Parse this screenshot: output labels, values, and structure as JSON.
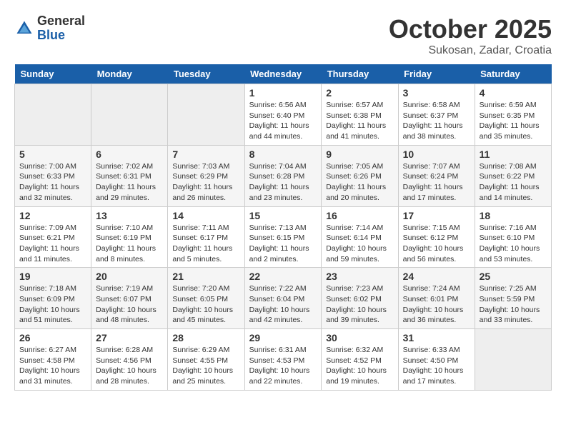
{
  "logo": {
    "general": "General",
    "blue": "Blue"
  },
  "title": "October 2025",
  "subtitle": "Sukosan, Zadar, Croatia",
  "days_of_week": [
    "Sunday",
    "Monday",
    "Tuesday",
    "Wednesday",
    "Thursday",
    "Friday",
    "Saturday"
  ],
  "weeks": [
    [
      {
        "day": "",
        "info": ""
      },
      {
        "day": "",
        "info": ""
      },
      {
        "day": "",
        "info": ""
      },
      {
        "day": "1",
        "info": "Sunrise: 6:56 AM\nSunset: 6:40 PM\nDaylight: 11 hours and 44 minutes."
      },
      {
        "day": "2",
        "info": "Sunrise: 6:57 AM\nSunset: 6:38 PM\nDaylight: 11 hours and 41 minutes."
      },
      {
        "day": "3",
        "info": "Sunrise: 6:58 AM\nSunset: 6:37 PM\nDaylight: 11 hours and 38 minutes."
      },
      {
        "day": "4",
        "info": "Sunrise: 6:59 AM\nSunset: 6:35 PM\nDaylight: 11 hours and 35 minutes."
      }
    ],
    [
      {
        "day": "5",
        "info": "Sunrise: 7:00 AM\nSunset: 6:33 PM\nDaylight: 11 hours and 32 minutes."
      },
      {
        "day": "6",
        "info": "Sunrise: 7:02 AM\nSunset: 6:31 PM\nDaylight: 11 hours and 29 minutes."
      },
      {
        "day": "7",
        "info": "Sunrise: 7:03 AM\nSunset: 6:29 PM\nDaylight: 11 hours and 26 minutes."
      },
      {
        "day": "8",
        "info": "Sunrise: 7:04 AM\nSunset: 6:28 PM\nDaylight: 11 hours and 23 minutes."
      },
      {
        "day": "9",
        "info": "Sunrise: 7:05 AM\nSunset: 6:26 PM\nDaylight: 11 hours and 20 minutes."
      },
      {
        "day": "10",
        "info": "Sunrise: 7:07 AM\nSunset: 6:24 PM\nDaylight: 11 hours and 17 minutes."
      },
      {
        "day": "11",
        "info": "Sunrise: 7:08 AM\nSunset: 6:22 PM\nDaylight: 11 hours and 14 minutes."
      }
    ],
    [
      {
        "day": "12",
        "info": "Sunrise: 7:09 AM\nSunset: 6:21 PM\nDaylight: 11 hours and 11 minutes."
      },
      {
        "day": "13",
        "info": "Sunrise: 7:10 AM\nSunset: 6:19 PM\nDaylight: 11 hours and 8 minutes."
      },
      {
        "day": "14",
        "info": "Sunrise: 7:11 AM\nSunset: 6:17 PM\nDaylight: 11 hours and 5 minutes."
      },
      {
        "day": "15",
        "info": "Sunrise: 7:13 AM\nSunset: 6:15 PM\nDaylight: 11 hours and 2 minutes."
      },
      {
        "day": "16",
        "info": "Sunrise: 7:14 AM\nSunset: 6:14 PM\nDaylight: 10 hours and 59 minutes."
      },
      {
        "day": "17",
        "info": "Sunrise: 7:15 AM\nSunset: 6:12 PM\nDaylight: 10 hours and 56 minutes."
      },
      {
        "day": "18",
        "info": "Sunrise: 7:16 AM\nSunset: 6:10 PM\nDaylight: 10 hours and 53 minutes."
      }
    ],
    [
      {
        "day": "19",
        "info": "Sunrise: 7:18 AM\nSunset: 6:09 PM\nDaylight: 10 hours and 51 minutes."
      },
      {
        "day": "20",
        "info": "Sunrise: 7:19 AM\nSunset: 6:07 PM\nDaylight: 10 hours and 48 minutes."
      },
      {
        "day": "21",
        "info": "Sunrise: 7:20 AM\nSunset: 6:05 PM\nDaylight: 10 hours and 45 minutes."
      },
      {
        "day": "22",
        "info": "Sunrise: 7:22 AM\nSunset: 6:04 PM\nDaylight: 10 hours and 42 minutes."
      },
      {
        "day": "23",
        "info": "Sunrise: 7:23 AM\nSunset: 6:02 PM\nDaylight: 10 hours and 39 minutes."
      },
      {
        "day": "24",
        "info": "Sunrise: 7:24 AM\nSunset: 6:01 PM\nDaylight: 10 hours and 36 minutes."
      },
      {
        "day": "25",
        "info": "Sunrise: 7:25 AM\nSunset: 5:59 PM\nDaylight: 10 hours and 33 minutes."
      }
    ],
    [
      {
        "day": "26",
        "info": "Sunrise: 6:27 AM\nSunset: 4:58 PM\nDaylight: 10 hours and 31 minutes."
      },
      {
        "day": "27",
        "info": "Sunrise: 6:28 AM\nSunset: 4:56 PM\nDaylight: 10 hours and 28 minutes."
      },
      {
        "day": "28",
        "info": "Sunrise: 6:29 AM\nSunset: 4:55 PM\nDaylight: 10 hours and 25 minutes."
      },
      {
        "day": "29",
        "info": "Sunrise: 6:31 AM\nSunset: 4:53 PM\nDaylight: 10 hours and 22 minutes."
      },
      {
        "day": "30",
        "info": "Sunrise: 6:32 AM\nSunset: 4:52 PM\nDaylight: 10 hours and 19 minutes."
      },
      {
        "day": "31",
        "info": "Sunrise: 6:33 AM\nSunset: 4:50 PM\nDaylight: 10 hours and 17 minutes."
      },
      {
        "day": "",
        "info": ""
      }
    ]
  ]
}
